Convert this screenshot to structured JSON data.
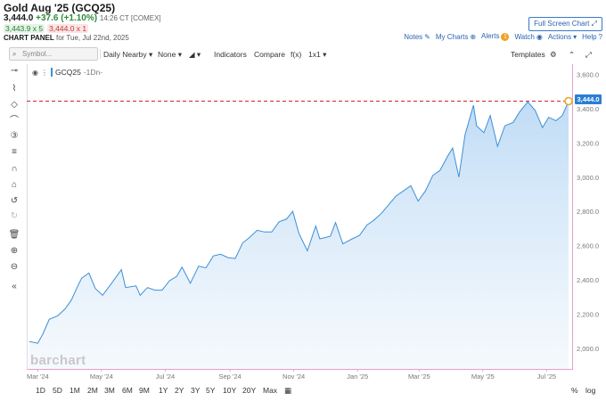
{
  "header": {
    "title": "Gold Aug '25 (GCQ25)",
    "last": "3,444.0",
    "change": "+37.6 (+1.10%)",
    "time": "14:26 CT [COMEX]",
    "bid": "3,443.9 x 5",
    "ask": "3,444.0 x 1",
    "panel_label": "CHART PANEL",
    "panel_date": "for Tue, Jul 22nd, 2025",
    "fullscreen": "Full Screen Chart ⤢"
  },
  "toplinks": {
    "notes": "Notes",
    "mycharts": "My Charts",
    "alerts": "Alerts",
    "alerts_count": "1",
    "watch": "Watch",
    "actions": "Actions",
    "help": "Help"
  },
  "toolbar": {
    "symbol_placeholder": "Symbol...",
    "period": "Daily Nearby",
    "overlay": "None",
    "indicators": "Indicators",
    "compare": "Compare",
    "fx": "f(x)",
    "layout": "1x1",
    "templates": "Templates"
  },
  "legend": {
    "symbol": "GCQ25",
    "interval": "-1Dn-"
  },
  "watermark": "barchart",
  "price_tag": "3,444.0",
  "ranges": [
    "1D",
    "5D",
    "1M",
    "2M",
    "3M",
    "6M",
    "9M",
    "1Y",
    "2Y",
    "3Y",
    "5Y",
    "10Y",
    "20Y",
    "Max"
  ],
  "scale_opts": {
    "pct": "%",
    "log": "log"
  },
  "colors": {
    "line": "#3d8fd6",
    "fill_top": "#bcdaf5",
    "ref_line": "#cc2233",
    "marker": "#f0a020"
  },
  "chart_data": {
    "type": "area",
    "y_ticks": [
      "2,000.0",
      "2,200.0",
      "2,400.0",
      "2,600.0",
      "2,800.0",
      "3,000.0",
      "3,200.0",
      "3,400.0",
      "3,600.0"
    ],
    "x_ticks": [
      "Mar '24",
      "May '24",
      "Jul '24",
      "Sep '24",
      "Nov '24",
      "Jan '25",
      "Mar '25",
      "May '25",
      "Jul '25"
    ],
    "ylim": [
      1880,
      3660
    ],
    "reference_price": 3444.0,
    "points": [
      [
        "2024-02-22",
        2040
      ],
      [
        "2024-03-01",
        2030
      ],
      [
        "2024-03-06",
        2085
      ],
      [
        "2024-03-12",
        2170
      ],
      [
        "2024-03-20",
        2190
      ],
      [
        "2024-03-27",
        2230
      ],
      [
        "2024-04-02",
        2280
      ],
      [
        "2024-04-08",
        2360
      ],
      [
        "2024-04-12",
        2410
      ],
      [
        "2024-04-19",
        2440
      ],
      [
        "2024-04-25",
        2350
      ],
      [
        "2024-05-02",
        2310
      ],
      [
        "2024-05-10",
        2375
      ],
      [
        "2024-05-20",
        2460
      ],
      [
        "2024-05-24",
        2355
      ],
      [
        "2024-06-03",
        2365
      ],
      [
        "2024-06-07",
        2310
      ],
      [
        "2024-06-14",
        2355
      ],
      [
        "2024-06-21",
        2340
      ],
      [
        "2024-06-28",
        2340
      ],
      [
        "2024-07-05",
        2395
      ],
      [
        "2024-07-12",
        2420
      ],
      [
        "2024-07-17",
        2475
      ],
      [
        "2024-07-25",
        2380
      ],
      [
        "2024-08-02",
        2480
      ],
      [
        "2024-08-09",
        2470
      ],
      [
        "2024-08-16",
        2540
      ],
      [
        "2024-08-23",
        2550
      ],
      [
        "2024-08-30",
        2530
      ],
      [
        "2024-09-06",
        2525
      ],
      [
        "2024-09-13",
        2615
      ],
      [
        "2024-09-20",
        2650
      ],
      [
        "2024-09-27",
        2690
      ],
      [
        "2024-10-04",
        2680
      ],
      [
        "2024-10-11",
        2680
      ],
      [
        "2024-10-18",
        2740
      ],
      [
        "2024-10-25",
        2755
      ],
      [
        "2024-10-31",
        2800
      ],
      [
        "2024-11-06",
        2670
      ],
      [
        "2024-11-14",
        2570
      ],
      [
        "2024-11-22",
        2715
      ],
      [
        "2024-11-26",
        2640
      ],
      [
        "2024-12-06",
        2655
      ],
      [
        "2024-12-11",
        2735
      ],
      [
        "2024-12-18",
        2610
      ],
      [
        "2024-12-27",
        2640
      ],
      [
        "2025-01-03",
        2660
      ],
      [
        "2025-01-10",
        2720
      ],
      [
        "2025-01-17",
        2750
      ],
      [
        "2025-01-24",
        2790
      ],
      [
        "2025-01-31",
        2840
      ],
      [
        "2025-02-07",
        2890
      ],
      [
        "2025-02-14",
        2920
      ],
      [
        "2025-02-21",
        2950
      ],
      [
        "2025-02-28",
        2860
      ],
      [
        "2025-03-07",
        2920
      ],
      [
        "2025-03-14",
        3010
      ],
      [
        "2025-03-21",
        3040
      ],
      [
        "2025-03-28",
        3120
      ],
      [
        "2025-04-02",
        3170
      ],
      [
        "2025-04-08",
        3000
      ],
      [
        "2025-04-14",
        3250
      ],
      [
        "2025-04-22",
        3420
      ],
      [
        "2025-04-25",
        3300
      ],
      [
        "2025-05-02",
        3260
      ],
      [
        "2025-05-08",
        3360
      ],
      [
        "2025-05-15",
        3180
      ],
      [
        "2025-05-22",
        3300
      ],
      [
        "2025-05-30",
        3320
      ],
      [
        "2025-06-05",
        3380
      ],
      [
        "2025-06-13",
        3440
      ],
      [
        "2025-06-20",
        3390
      ],
      [
        "2025-06-27",
        3290
      ],
      [
        "2025-07-03",
        3350
      ],
      [
        "2025-07-10",
        3330
      ],
      [
        "2025-07-16",
        3360
      ],
      [
        "2025-07-22",
        3444
      ]
    ]
  }
}
